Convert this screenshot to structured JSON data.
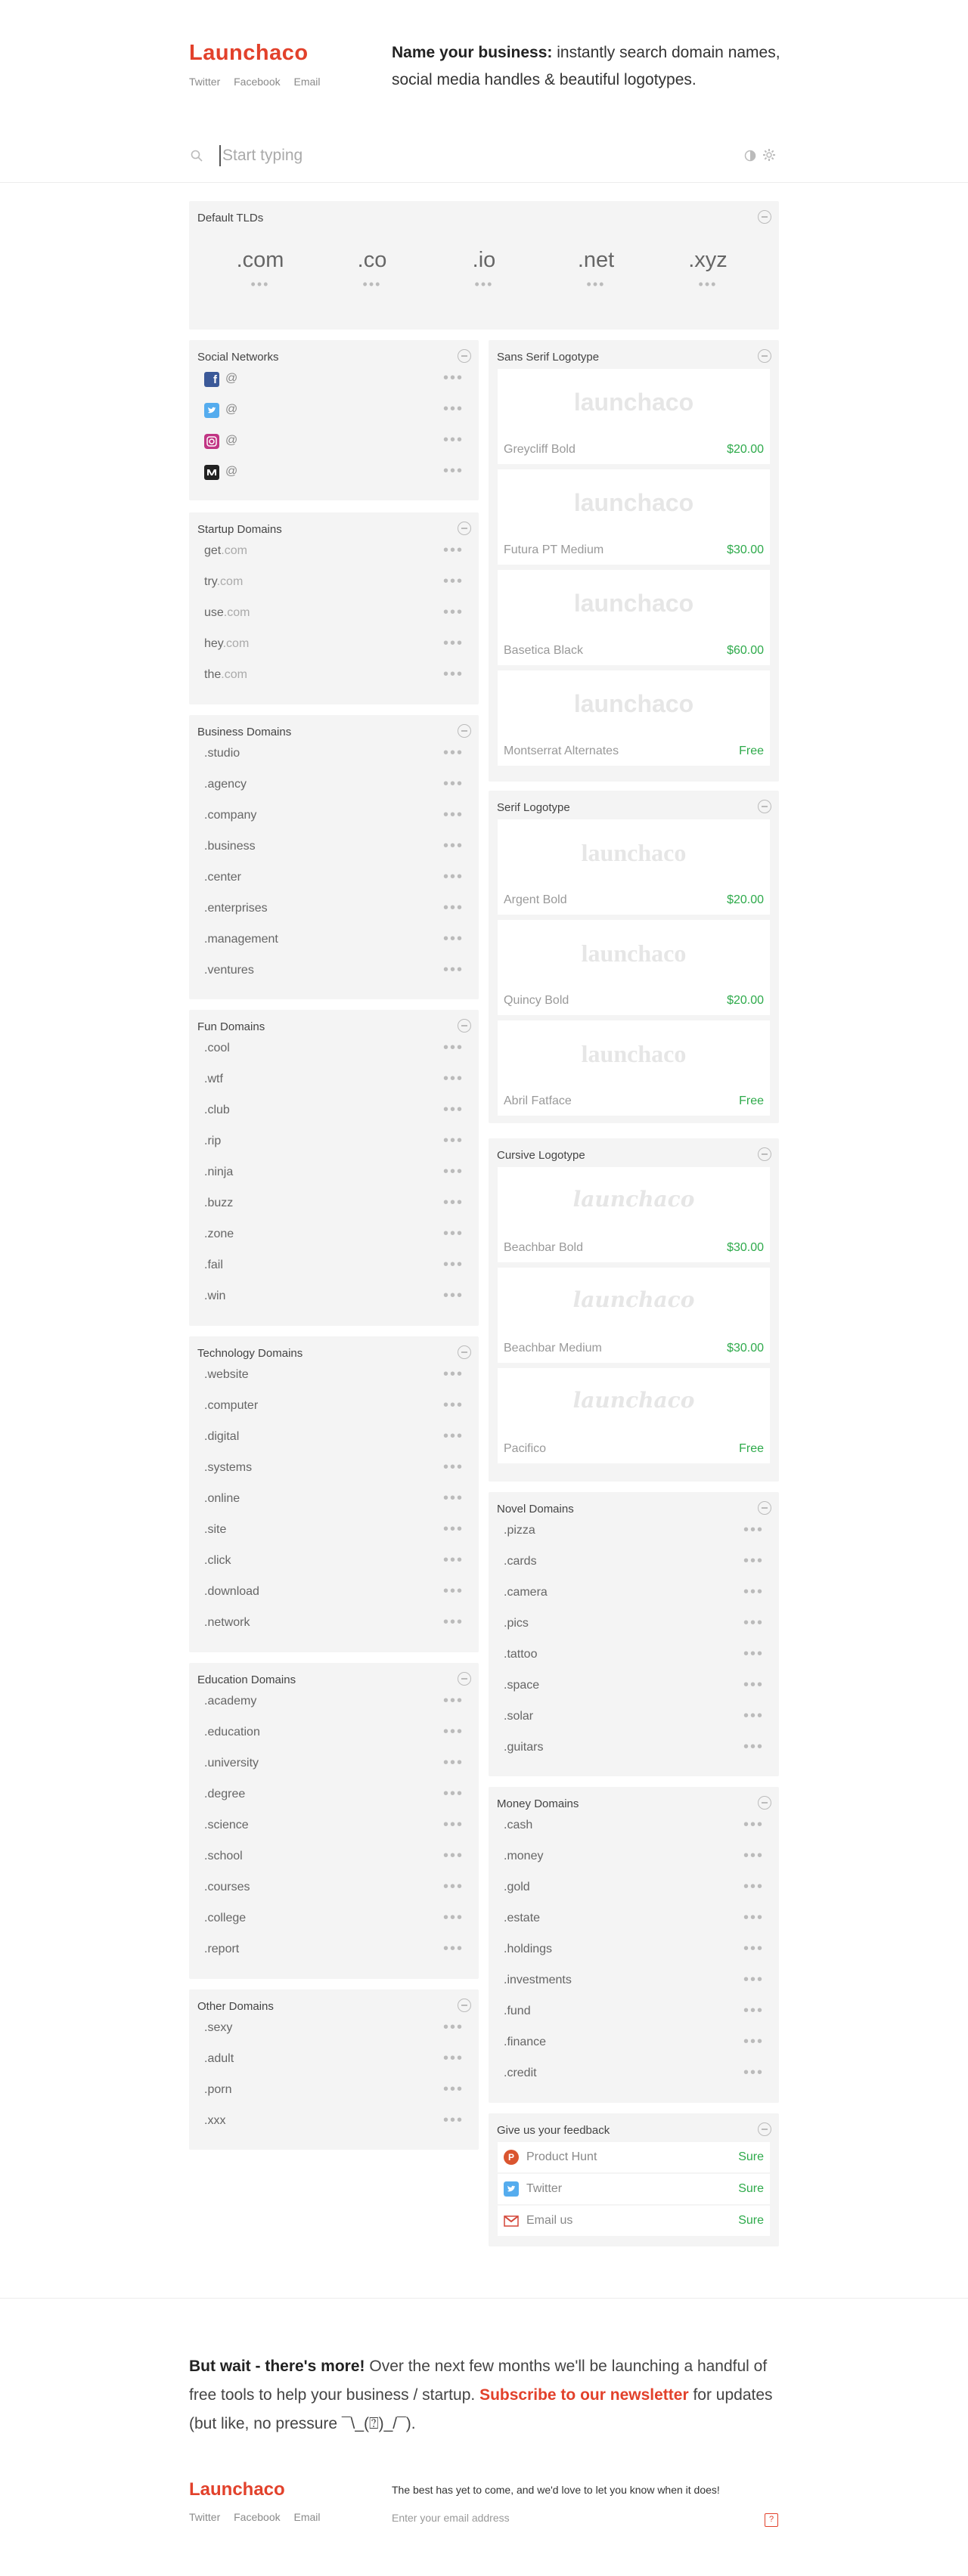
{
  "header": {
    "logo": "Launchaco",
    "social": [
      "Twitter",
      "Facebook",
      "Email"
    ],
    "tagline_bold": "Name your business:",
    "tagline_rest": "instantly search domain names, social media handles & beautiful logotypes."
  },
  "search": {
    "placeholder": "Start typing"
  },
  "default_tlds": {
    "title": "Default TLDs",
    "items": [
      ".com",
      ".co",
      ".io",
      ".net",
      ".xyz"
    ],
    "status": "•••"
  },
  "social_networks": {
    "title": "Social Networks",
    "items": [
      {
        "icon": "facebook-icon",
        "color": "#3b5998",
        "label": "@"
      },
      {
        "icon": "twitter-icon",
        "color": "#55acee",
        "label": "@"
      },
      {
        "icon": "instagram-icon",
        "color": "#c13584",
        "label": "@"
      },
      {
        "icon": "medium-icon",
        "color": "#222222",
        "label": "@"
      }
    ]
  },
  "startup_domains": {
    "title": "Startup Domains",
    "items": [
      {
        "prefix": "get",
        "suffix": ".com"
      },
      {
        "prefix": "try",
        "suffix": ".com"
      },
      {
        "prefix": "use",
        "suffix": ".com"
      },
      {
        "prefix": "hey",
        "suffix": ".com"
      },
      {
        "prefix": "the",
        "suffix": ".com"
      }
    ]
  },
  "business_domains": {
    "title": "Business Domains",
    "items": [
      ".studio",
      ".agency",
      ".company",
      ".business",
      ".center",
      ".enterprises",
      ".management",
      ".ventures"
    ]
  },
  "fun_domains": {
    "title": "Fun Domains",
    "items": [
      ".cool",
      ".wtf",
      ".club",
      ".rip",
      ".ninja",
      ".buzz",
      ".zone",
      ".fail",
      ".win"
    ]
  },
  "technology_domains": {
    "title": "Technology Domains",
    "items": [
      ".website",
      ".computer",
      ".digital",
      ".systems",
      ".online",
      ".site",
      ".click",
      ".download",
      ".network"
    ]
  },
  "education_domains": {
    "title": "Education Domains",
    "items": [
      ".academy",
      ".education",
      ".university",
      ".degree",
      ".science",
      ".school",
      ".courses",
      ".college",
      ".report"
    ]
  },
  "other_domains": {
    "title": "Other Domains",
    "items": [
      ".sexy",
      ".adult",
      ".porn",
      ".xxx"
    ]
  },
  "sans_serif_logotype": {
    "title": "Sans Serif Logotype",
    "preview": "launchaco",
    "items": [
      {
        "font": "Greycliff Bold",
        "price": "$20.00"
      },
      {
        "font": "Futura PT Medium",
        "price": "$30.00"
      },
      {
        "font": "Basetica Black",
        "price": "$60.00"
      },
      {
        "font": "Montserrat Alternates",
        "price": "Free"
      }
    ]
  },
  "serif_logotype": {
    "title": "Serif Logotype",
    "preview": "launchaco",
    "items": [
      {
        "font": "Argent Bold",
        "price": "$20.00"
      },
      {
        "font": "Quincy Bold",
        "price": "$20.00"
      },
      {
        "font": "Abril Fatface",
        "price": "Free"
      }
    ]
  },
  "cursive_logotype": {
    "title": "Cursive Logotype",
    "preview": "launchaco",
    "items": [
      {
        "font": "Beachbar Bold",
        "price": "$30.00"
      },
      {
        "font": "Beachbar Medium",
        "price": "$30.00"
      },
      {
        "font": "Pacifico",
        "price": "Free"
      }
    ]
  },
  "novel_domains": {
    "title": "Novel Domains",
    "items": [
      ".pizza",
      ".cards",
      ".camera",
      ".pics",
      ".tattoo",
      ".space",
      ".solar",
      ".guitars"
    ]
  },
  "money_domains": {
    "title": "Money Domains",
    "items": [
      ".cash",
      ".money",
      ".gold",
      ".estate",
      ".holdings",
      ".investments",
      ".fund",
      ".finance",
      ".credit"
    ]
  },
  "feedback": {
    "title": "Give us your feedback",
    "items": [
      {
        "icon": "product-hunt-icon",
        "color": "#da552f",
        "label": "Product Hunt",
        "action": "Sure"
      },
      {
        "icon": "twitter-icon",
        "color": "#55acee",
        "label": "Twitter",
        "action": "Sure"
      },
      {
        "icon": "gmail-icon",
        "color": "#d44638",
        "label": "Email us",
        "action": "Sure"
      }
    ]
  },
  "more": {
    "bold": "But wait - there's more!",
    "text": "Over the next few months we'll be launching a handful of free tools to help your business / startup.",
    "link": "Subscribe to our newsletter",
    "tail": "for updates (but like, no pressure ¯\\_(⍰)_/¯)."
  },
  "footer": {
    "logo": "Launchaco",
    "social": [
      "Twitter",
      "Facebook",
      "Email"
    ],
    "note": "The best has yet to come, and we'd love to let you know when it does!",
    "email_placeholder": "Enter your email address",
    "submit": "?"
  }
}
